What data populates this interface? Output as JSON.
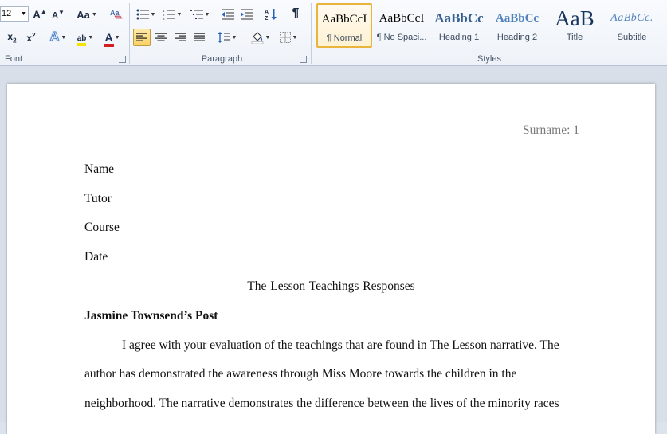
{
  "ribbon": {
    "font": {
      "size_value": "12",
      "grow_label": "A",
      "shrink_label": "A",
      "change_case_label": "Aa",
      "subscript_label": "x",
      "subscript_mark": "2",
      "superscript_label": "x",
      "superscript_mark": "2",
      "text_effects_label": "A",
      "highlight_label": "ab",
      "font_color_label": "A",
      "group_label": "Font"
    },
    "paragraph": {
      "pilcrow_label": "¶",
      "group_label": "Paragraph"
    },
    "styles": {
      "group_label": "Styles",
      "items": [
        {
          "preview": "AaBbCcI",
          "name": "¶ Normal"
        },
        {
          "preview": "AaBbCcI",
          "name": "¶ No Spaci..."
        },
        {
          "preview": "AaBbCc",
          "name": "Heading 1"
        },
        {
          "preview": "AaBbCc",
          "name": "Heading 2"
        },
        {
          "preview": "AaB",
          "name": "Title"
        },
        {
          "preview": "AaBbCc.",
          "name": "Subtitle"
        }
      ]
    },
    "colors": {
      "highlight": "#f5e400",
      "font_color": "#d21f1f",
      "heading_blue": "#365f91",
      "heading2_blue": "#4f81bd",
      "title_blue": "#17365d"
    }
  },
  "document": {
    "header_text": "Surname: 1",
    "lines": {
      "name": "Name",
      "tutor": "Tutor",
      "course": "Course",
      "date": "Date",
      "title": "The Lesson Teachings Responses",
      "post_heading": "Jasmine Townsend’s Post",
      "body1": "I agree with your evaluation of the teachings that are found in The Lesson narrative. The",
      "body2": "author has demonstrated the awareness through Miss Moore towards the children in the",
      "body3": "neighborhood. The narrative demonstrates the difference between the lives of the minority races"
    }
  }
}
